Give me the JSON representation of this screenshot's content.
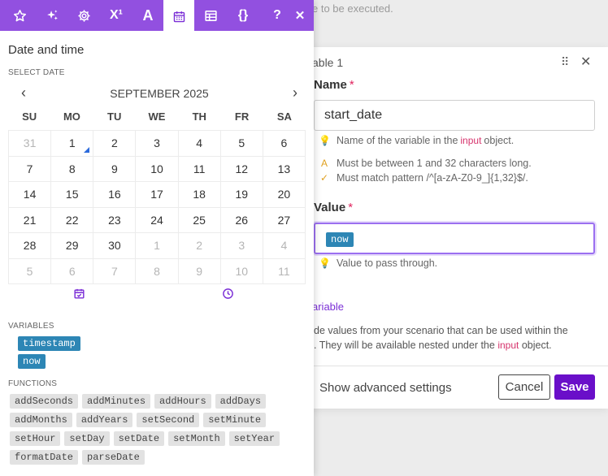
{
  "background": {
    "top_text": "e to be executed.",
    "panel_title": "able 1",
    "name_label": "Name",
    "name_value": "start_date",
    "name_hint": "Name of the variable in the",
    "name_hint_code": "input",
    "name_hint_tail": "object.",
    "rule_1": "Must be between 1 and 32 characters long.",
    "rule_2": "Must match pattern /^[a-zA-Z0-9_]{1,32}$/.",
    "value_label": "Value",
    "value_pill": "now",
    "value_hint": "Value to pass through.",
    "add_link": "ariable",
    "para_line1": "de values from your scenario that can be used within the",
    "para_line2": ". They will be available nested under the",
    "para_code": "input",
    "para_tail": "object.",
    "advanced_label": "Show advanced settings",
    "cancel_label": "Cancel",
    "save_label": "Save",
    "required_mark": "*"
  },
  "picker": {
    "toolbar": {
      "icons": [
        "star-icon",
        "sparkles-icon",
        "gear-icon",
        "superscript-icon",
        "text-icon",
        "calendar-icon",
        "table-icon",
        "braces-icon",
        "help-icon",
        "close-icon"
      ],
      "active": "calendar-icon",
      "superscript_label": "X¹",
      "text_label": "A",
      "braces_label": "{}",
      "help_label": "?",
      "close_label": "✕"
    },
    "title": "Date and time",
    "select_date_label": "SELECT DATE",
    "month_title": "SEPTEMBER 2025",
    "weekdays": [
      "SU",
      "MO",
      "TU",
      "WE",
      "TH",
      "FR",
      "SA"
    ],
    "weeks": [
      [
        "31",
        "1",
        "2",
        "3",
        "4",
        "5",
        "6"
      ],
      [
        "7",
        "8",
        "9",
        "10",
        "11",
        "12",
        "13"
      ],
      [
        "14",
        "15",
        "16",
        "17",
        "18",
        "19",
        "20"
      ],
      [
        "21",
        "22",
        "23",
        "24",
        "25",
        "26",
        "27"
      ],
      [
        "28",
        "29",
        "30",
        "1",
        "2",
        "3",
        "4"
      ],
      [
        "5",
        "6",
        "7",
        "8",
        "9",
        "10",
        "11"
      ]
    ],
    "variables_label": "VARIABLES",
    "variables": [
      "timestamp",
      "now"
    ],
    "functions_label": "FUNCTIONS",
    "functions": [
      [
        "addSeconds",
        "addMinutes",
        "addHours",
        "addDays"
      ],
      [
        "addMonths",
        "addYears",
        "setSecond",
        "setMinute"
      ],
      [
        "setHour",
        "setDay",
        "setDate",
        "setMonth",
        "setYear"
      ],
      [
        "formatDate",
        "parseDate"
      ]
    ]
  }
}
